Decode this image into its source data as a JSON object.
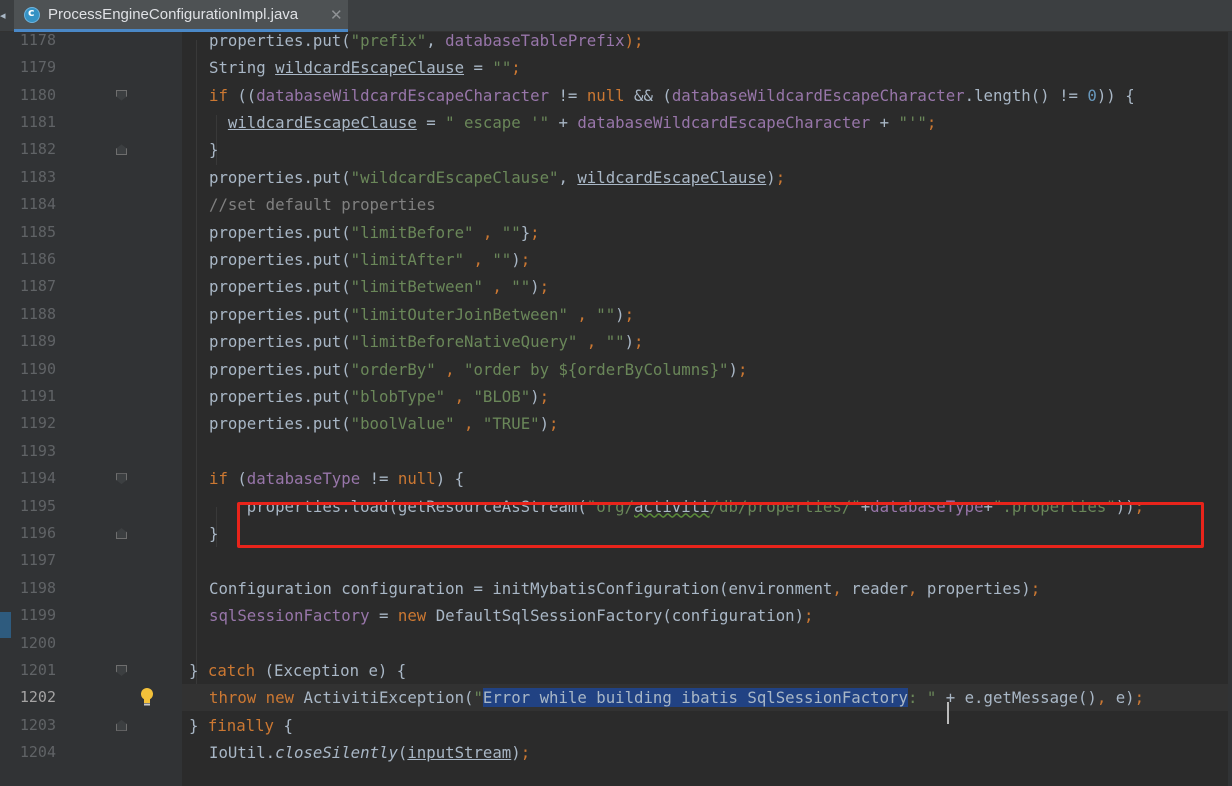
{
  "tab": {
    "file_name": "ProcessEngineConfigurationImpl.java",
    "close_glyph": "✕",
    "icon": "java-class-icon"
  },
  "editor": {
    "current_line": "1202",
    "lines": [
      {
        "n": "1178",
        "code": [
          [
            "",
            "properties.put("
          ],
          [
            "str",
            "\"prefix\""
          ],
          [
            "",
            ", "
          ],
          [
            "fld",
            "databaseTablePrefix"
          ],
          [
            "kw",
            ");"
          ]
        ]
      },
      {
        "n": "1179",
        "code": [
          [
            "",
            "String "
          ],
          [
            "ul",
            "wildcardEscapeClause"
          ],
          [
            "",
            " = "
          ],
          [
            "str",
            "\"\""
          ],
          [
            "kw",
            ";"
          ]
        ]
      },
      {
        "n": "1180",
        "code": [
          [
            "kw",
            "if "
          ],
          [
            "",
            "(("
          ],
          [
            "fld",
            "databaseWildcardEscapeCharacter"
          ],
          [
            "",
            " != "
          ],
          [
            "kw",
            "null"
          ],
          [
            "",
            " && ("
          ],
          [
            "fld",
            "databaseWildcardEscapeCharacter"
          ],
          [
            "",
            ".length() != "
          ],
          [
            "num",
            "0"
          ],
          [
            "",
            ")) {"
          ]
        ]
      },
      {
        "n": "1181",
        "code": [
          [
            "",
            "  "
          ],
          [
            "ul",
            "wildcardEscapeClause"
          ],
          [
            "",
            " = "
          ],
          [
            "str",
            "\" escape '\""
          ],
          [
            "",
            " + "
          ],
          [
            "fld",
            "databaseWildcardEscapeCharacter"
          ],
          [
            "",
            " + "
          ],
          [
            "str",
            "\"'\""
          ],
          [
            "kw",
            ";"
          ]
        ]
      },
      {
        "n": "1182",
        "code": [
          [
            "",
            "}"
          ]
        ]
      },
      {
        "n": "1183",
        "code": [
          [
            "",
            "properties.put("
          ],
          [
            "str",
            "\"wildcardEscapeClause\""
          ],
          [
            "",
            ", "
          ],
          [
            "ul",
            "wildcardEscapeClause"
          ],
          [
            "",
            ")"
          ],
          [
            "kw",
            ";"
          ]
        ]
      },
      {
        "n": "1184",
        "code": [
          [
            "cmt",
            "//set default properties"
          ]
        ]
      },
      {
        "n": "1185",
        "code": [
          [
            "",
            "properties.put("
          ],
          [
            "str",
            "\"limitBefore\""
          ],
          [
            "kw",
            " , "
          ],
          [
            "str",
            "\"\""
          ],
          [
            "",
            "}"
          ],
          [
            "kw",
            ";"
          ]
        ]
      },
      {
        "n": "1186",
        "code": [
          [
            "",
            "properties.put("
          ],
          [
            "str",
            "\"limitAfter\""
          ],
          [
            "kw",
            " , "
          ],
          [
            "str",
            "\"\""
          ],
          [
            "",
            ")"
          ],
          [
            "kw",
            ";"
          ]
        ]
      },
      {
        "n": "1187",
        "code": [
          [
            "",
            "properties.put("
          ],
          [
            "str",
            "\"limitBetween\""
          ],
          [
            "kw",
            " , "
          ],
          [
            "str",
            "\"\""
          ],
          [
            "",
            ")"
          ],
          [
            "kw",
            ";"
          ]
        ]
      },
      {
        "n": "1188",
        "code": [
          [
            "",
            "properties.put("
          ],
          [
            "str",
            "\"limitOuterJoinBetween\""
          ],
          [
            "kw",
            " , "
          ],
          [
            "str",
            "\"\""
          ],
          [
            "",
            ")"
          ],
          [
            "kw",
            ";"
          ]
        ]
      },
      {
        "n": "1189",
        "code": [
          [
            "",
            "properties.put("
          ],
          [
            "str",
            "\"limitBeforeNativeQuery\""
          ],
          [
            "kw",
            " , "
          ],
          [
            "str",
            "\"\""
          ],
          [
            "",
            ")"
          ],
          [
            "kw",
            ";"
          ]
        ]
      },
      {
        "n": "1190",
        "code": [
          [
            "",
            "properties.put("
          ],
          [
            "str",
            "\"orderBy\""
          ],
          [
            "kw",
            " , "
          ],
          [
            "str",
            "\"order by ${orderByColumns}\""
          ],
          [
            "",
            ")"
          ],
          [
            "kw",
            ";"
          ]
        ]
      },
      {
        "n": "1191",
        "code": [
          [
            "",
            "properties.put("
          ],
          [
            "str",
            "\"blobType\""
          ],
          [
            "kw",
            " , "
          ],
          [
            "str",
            "\"BLOB\""
          ],
          [
            "",
            ")"
          ],
          [
            "kw",
            ";"
          ]
        ]
      },
      {
        "n": "1192",
        "code": [
          [
            "",
            "properties.put("
          ],
          [
            "str",
            "\"boolValue\""
          ],
          [
            "kw",
            " , "
          ],
          [
            "str",
            "\"TRUE\""
          ],
          [
            "",
            ")"
          ],
          [
            "kw",
            ";"
          ]
        ]
      },
      {
        "n": "1193",
        "code": []
      },
      {
        "n": "1194",
        "code": [
          [
            "kw",
            "if "
          ],
          [
            "",
            "("
          ],
          [
            "fld",
            "databaseType"
          ],
          [
            "",
            " != "
          ],
          [
            "kw",
            "null"
          ],
          [
            "",
            ") {"
          ]
        ]
      },
      {
        "n": "1195",
        "code": [
          [
            "",
            "    properties.load(getResourceAsStream("
          ],
          [
            "str",
            "\"org/"
          ],
          [
            "wv",
            "activiti"
          ],
          [
            "str",
            "/db/properties/\""
          ],
          [
            "",
            "+"
          ],
          [
            "fld",
            "databaseType"
          ],
          [
            "",
            "+"
          ],
          [
            "str",
            "\".properties\""
          ],
          [
            "",
            "))"
          ],
          [
            "kw",
            ";"
          ]
        ]
      },
      {
        "n": "1196",
        "code": [
          [
            "",
            "}"
          ]
        ]
      },
      {
        "n": "1197",
        "code": []
      },
      {
        "n": "1198",
        "code": [
          [
            "",
            "Configuration configuration = initMybatisConfiguration(environment"
          ],
          [
            "kw",
            ", "
          ],
          [
            "",
            "reader"
          ],
          [
            "kw",
            ", "
          ],
          [
            "",
            "properties)"
          ],
          [
            "kw",
            ";"
          ]
        ]
      },
      {
        "n": "1199",
        "code": [
          [
            "fld",
            "sqlSessionFactory"
          ],
          [
            "",
            " = "
          ],
          [
            "kw",
            "new "
          ],
          [
            "",
            "DefaultSqlSessionFactory(configuration)"
          ],
          [
            "kw",
            ";"
          ]
        ]
      },
      {
        "n": "1200",
        "code": []
      },
      {
        "n": "1201",
        "code": [
          [
            "",
            "} "
          ],
          [
            "kw",
            "catch "
          ],
          [
            "",
            "(Exception e) {"
          ]
        ]
      },
      {
        "n": "1202",
        "code": [
          [
            "kw",
            "throw new "
          ],
          [
            "",
            "ActivitiException("
          ],
          [
            "str",
            "\""
          ],
          [
            "sel",
            "Error while building ibatis SqlSessionFactory"
          ],
          [
            "str",
            ": \""
          ],
          [
            "",
            " + e.getMessage()"
          ],
          [
            "kw",
            ", "
          ],
          [
            "",
            "e)"
          ],
          [
            "kw",
            ";"
          ]
        ]
      },
      {
        "n": "1203",
        "code": [
          [
            "",
            "} "
          ],
          [
            "kw",
            "finally "
          ],
          [
            "",
            "{"
          ]
        ]
      },
      {
        "n": "1204",
        "code": [
          [
            "",
            "IoUtil."
          ],
          [
            "it",
            "closeSilently"
          ],
          [
            "",
            "("
          ],
          [
            "ul",
            "inputStream"
          ],
          [
            "",
            ")"
          ],
          [
            "kw",
            ";"
          ]
        ]
      }
    ]
  }
}
